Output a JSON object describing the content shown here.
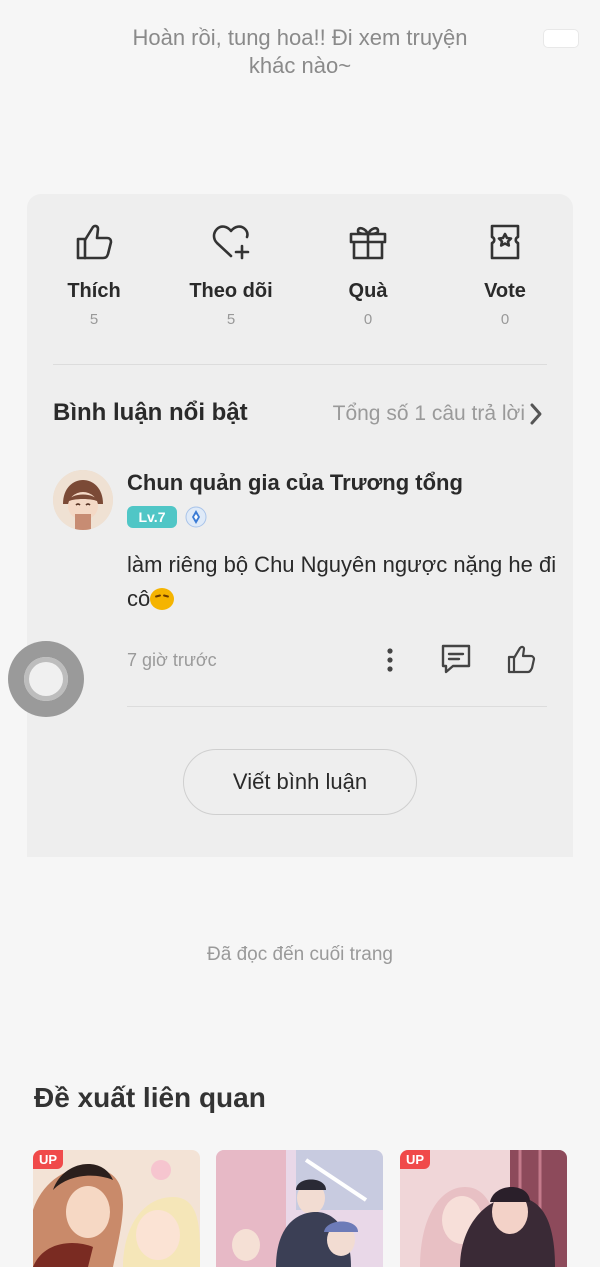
{
  "end_message": {
    "line1": "Hoàn rồi, tung hoa!! Đi xem truyện",
    "line2": "khác nào~"
  },
  "actions": [
    {
      "label": "Thích",
      "count": "5",
      "icon": "thumbs-up-icon"
    },
    {
      "label": "Theo dõi",
      "count": "5",
      "icon": "heart-plus-icon"
    },
    {
      "label": "Quà",
      "count": "0",
      "icon": "gift-icon"
    },
    {
      "label": "Vote",
      "count": "0",
      "icon": "vote-ticket-icon"
    }
  ],
  "comments_section": {
    "title": "Bình luận nổi bật",
    "total_label": "Tổng số 1 câu trả lời"
  },
  "comment": {
    "username": "Chun quản gia của Trương tổng",
    "level": "Lv.7",
    "text": "làm riêng bộ Chu Nguyên ngược nặng he đi cô",
    "time": "7 giờ trước"
  },
  "write_comment_label": "Viết bình luận",
  "read_end_label": "Đã đọc đến cuối trang",
  "recommend": {
    "title": "Đề xuất liên quan",
    "items": [
      {
        "badge": "UP",
        "colors": [
          "#c98a6a",
          "#f3e3d6",
          "#7a2b22"
        ]
      },
      {
        "badge": "",
        "colors": [
          "#e7b9c6",
          "#c8cbe0",
          "#3b3f55"
        ]
      },
      {
        "badge": "UP",
        "colors": [
          "#e8c0c4",
          "#8d4a5b",
          "#3a2a36"
        ]
      }
    ]
  },
  "colors": {
    "accent_level": "#50c6c6",
    "badge_up": "#f04a4a",
    "vip_blue": "#3a7bd5"
  }
}
